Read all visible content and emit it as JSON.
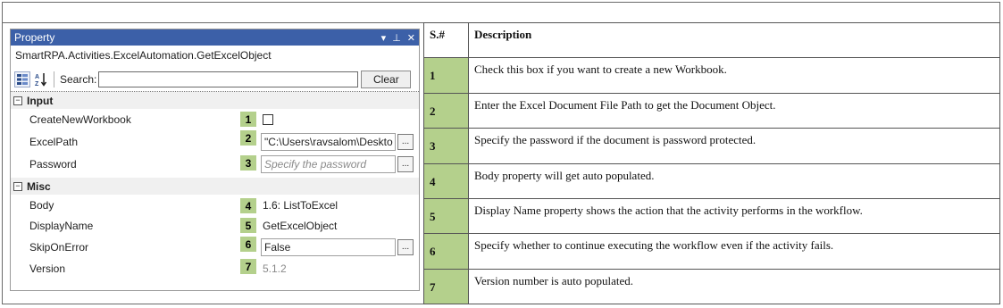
{
  "panel": {
    "title": "Property",
    "title_controls": {
      "pin": "▾",
      "dock": "⊥",
      "close": "✕"
    },
    "type_name": "SmartRPA.Activities.ExcelAutomation.GetExcelObject",
    "toolbar": {
      "categorized_icon": "categorized-icon",
      "alphabetical_icon": "sort-az-icon",
      "search_label": "Search:",
      "search_value": "",
      "clear_label": "Clear"
    },
    "categories": [
      {
        "label": "Input",
        "toggle": "−",
        "properties": [
          {
            "name": "CreateNewWorkbook",
            "badge": "1",
            "value": "",
            "kind": "checkbox"
          },
          {
            "name": "ExcelPath",
            "badge": "2",
            "value": "\"C:\\Users\\ravsalom\\Deskto",
            "kind": "text-ellipsis"
          },
          {
            "name": "Password",
            "badge": "3",
            "placeholder": "Specify  the password",
            "kind": "placeholder-ellipsis"
          }
        ]
      },
      {
        "label": "Misc",
        "toggle": "−",
        "properties": [
          {
            "name": "Body",
            "badge": "4",
            "value": "1.6: ListToExcel",
            "kind": "readonly"
          },
          {
            "name": "DisplayName",
            "badge": "5",
            "value": "GetExcelObject",
            "kind": "readonly"
          },
          {
            "name": "SkipOnError",
            "badge": "6",
            "value": "False",
            "kind": "text-ellipsis"
          },
          {
            "name": "Version",
            "badge": "7",
            "value": "5.1.2",
            "kind": "dim"
          }
        ]
      }
    ],
    "ellipsis_label": "..."
  },
  "table": {
    "headers": [
      "S.#",
      "Description"
    ],
    "rows": [
      {
        "num": "1",
        "text": "Check this box if you want to create a new Workbook."
      },
      {
        "num": "2",
        "text": "Enter the Excel Document File Path to get the Document Object."
      },
      {
        "num": "3",
        "text": "Specify the password if the document is password protected."
      },
      {
        "num": "4",
        "text": "Body property will get auto populated."
      },
      {
        "num": "5",
        "text": "Display Name property shows the action that the activity performs in the workflow."
      },
      {
        "num": "6",
        "text": "Specify whether to continue executing the workflow even if the activity fails."
      },
      {
        "num": "7",
        "text": "Version number is auto populated."
      }
    ]
  },
  "colors": {
    "title_bar": "#3c60a8",
    "badge": "#b4d08c",
    "category_bg": "#f0f0f0"
  }
}
